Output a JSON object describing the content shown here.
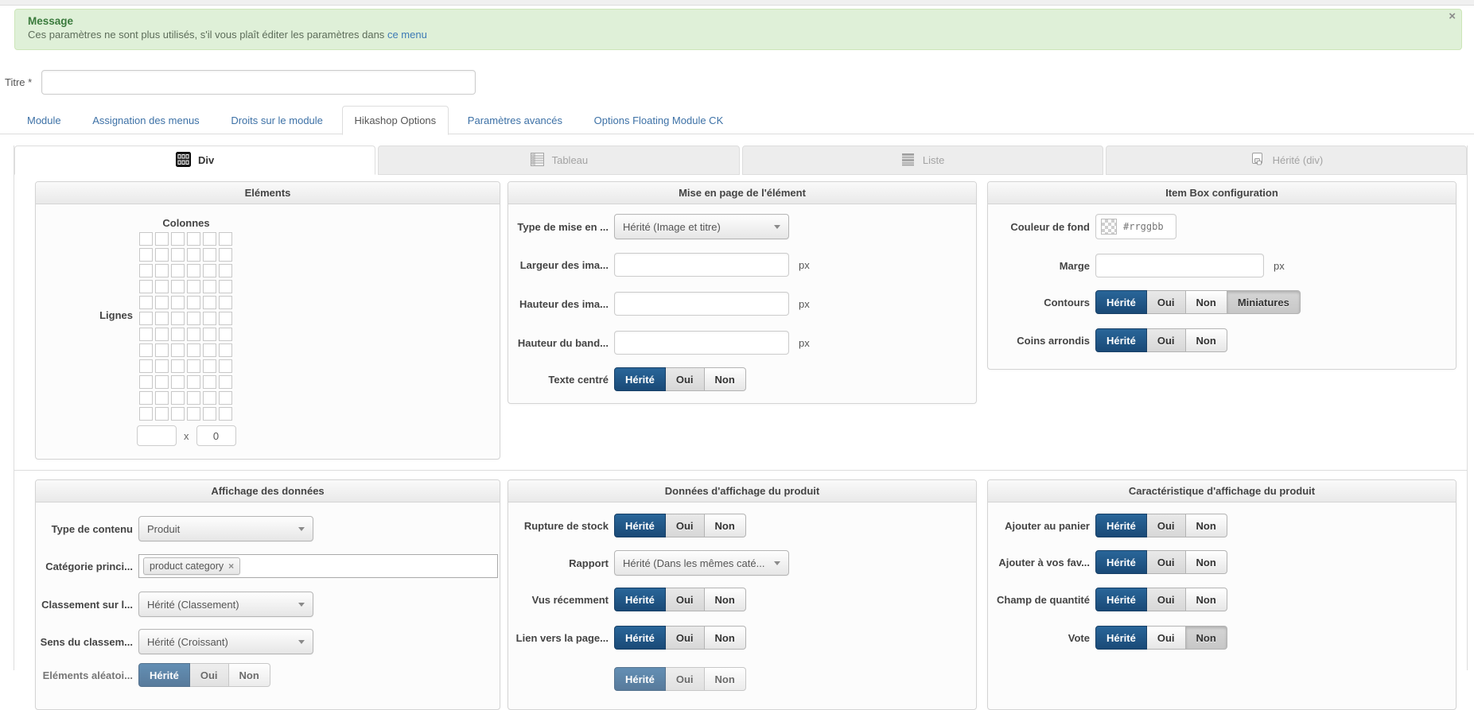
{
  "alert": {
    "title": "Message",
    "body": "Ces paramètres ne sont plus utilisés, s'il vous plaît éditer les paramètres dans",
    "link_label": "ce menu",
    "close_label": "×"
  },
  "title_field": {
    "label": "Titre *",
    "value": ""
  },
  "nav_tabs": {
    "active_index": 3,
    "items": [
      {
        "label": "Module"
      },
      {
        "label": "Assignation des menus"
      },
      {
        "label": "Droits sur le module"
      },
      {
        "label": "Hikashop Options"
      },
      {
        "label": "Paramètres avancés"
      },
      {
        "label": "Options Floating Module CK"
      }
    ]
  },
  "type_tabs": {
    "div": "Div",
    "tableau": "Tableau",
    "liste": "Liste",
    "herite": "Hérité (div)",
    "icons": [
      "grid-icon",
      "table-icon",
      "list-icon",
      "inherit-icon"
    ]
  },
  "buttons": {
    "herite": "Hérité",
    "oui": "Oui",
    "non": "Non",
    "miniatures": "Miniatures"
  },
  "units": {
    "px": "px"
  },
  "elements_panel": {
    "title": "Eléments",
    "columns_label": "Colonnes",
    "lignes_label": "Lignes",
    "grid": {
      "rows": 12,
      "cols": 6
    },
    "cols_value": "",
    "mult_sign": "x",
    "rows_value": "0"
  },
  "layout_panel": {
    "title": "Mise en page de l'élément",
    "type_label": "Type de mise en ...",
    "type_value": "Hérité (Image et titre)",
    "img_width_label": "Largeur des ima...",
    "img_height_label": "Hauteur des ima...",
    "band_height_label": "Hauteur du band...",
    "text_center_label": "Texte centré"
  },
  "itembox_panel": {
    "title": "Item Box configuration",
    "bg_label": "Couleur de fond",
    "bg_placeholder": "#rrggbb",
    "margin_label": "Marge",
    "contours_label": "Contours",
    "rounded_label": "Coins arrondis"
  },
  "data_panel": {
    "title": "Affichage des données",
    "content_type_label": "Type de contenu",
    "content_type_value": "Produit",
    "category_label": "Catégorie princi...",
    "category_tag": "product category",
    "tag_remove": "×",
    "order_label": "Classement sur l...",
    "order_value": "Hérité (Classement)",
    "order_dir_label": "Sens du classem...",
    "order_dir_value": "Hérité (Croissant)",
    "random_label": "Eléments aléatoi..."
  },
  "product_data_panel": {
    "title": "Données d'affichage du produit",
    "stock_label": "Rupture de stock",
    "report_label": "Rapport",
    "report_value": "Hérité (Dans les mêmes caté...",
    "recent_label": "Vus récemment",
    "page_link_label": "Lien vers la page..."
  },
  "features_panel": {
    "title": "Caractéristique d'affichage du produit",
    "cart_label": "Ajouter au panier",
    "wishlist_label": "Ajouter à vos fav...",
    "quantity_label": "Champ de quantité",
    "vote_label": "Vote"
  },
  "colors": {
    "active_blue": "#1f5587",
    "link_blue": "#3d71a6",
    "alert_green": "#3a7a3c",
    "alert_bg": "#dff0d8"
  }
}
